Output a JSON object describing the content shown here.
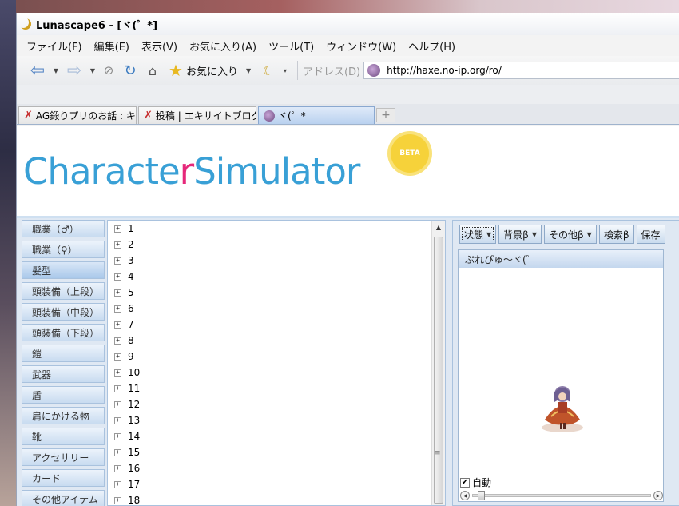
{
  "window": {
    "title": "Lunascape6 - [ヾ(゜*]"
  },
  "menu": [
    "ファイル(F)",
    "編集(E)",
    "表示(V)",
    "お気に入り(A)",
    "ツール(T)",
    "ウィンドウ(W)",
    "ヘルプ(H)"
  ],
  "toolbar": {
    "favorites_label": "お気に入り",
    "address_label": "アドレス(D)",
    "url": "http://haxe.no-ip.org/ro/"
  },
  "tabs": [
    {
      "label": "AG鍛りプリのお話 : キャ...",
      "active": false
    },
    {
      "label": "投稿 | エキサイトブログ",
      "active": false
    },
    {
      "label": "ヾ(゜*",
      "active": true
    }
  ],
  "banner": {
    "logo_main": "Characte",
    "logo_accent": "r",
    "logo_rest": "Simulator",
    "badge": "BETA"
  },
  "nav": [
    {
      "label": "職業（♂）",
      "selected": false
    },
    {
      "label": "職業（♀）",
      "selected": false
    },
    {
      "label": "髪型",
      "selected": true
    },
    {
      "label": "頭装備（上段）",
      "selected": false
    },
    {
      "label": "頭装備（中段）",
      "selected": false
    },
    {
      "label": "頭装備（下段）",
      "selected": false
    },
    {
      "label": "鎧",
      "selected": false
    },
    {
      "label": "武器",
      "selected": false
    },
    {
      "label": "盾",
      "selected": false
    },
    {
      "label": "肩にかける物",
      "selected": false
    },
    {
      "label": "靴",
      "selected": false
    },
    {
      "label": "アクセサリー",
      "selected": false
    },
    {
      "label": "カード",
      "selected": false
    },
    {
      "label": "その他アイテム",
      "selected": false
    }
  ],
  "tree_items": [
    "1",
    "2",
    "3",
    "4",
    "5",
    "6",
    "7",
    "8",
    "9",
    "10",
    "11",
    "12",
    "13",
    "14",
    "15",
    "16",
    "17",
    "18"
  ],
  "right_buttons": [
    {
      "label": "状態",
      "dropdown": true
    },
    {
      "label": "背景β",
      "dropdown": true
    },
    {
      "label": "その他β",
      "dropdown": true
    },
    {
      "label": "検索β",
      "dropdown": false
    },
    {
      "label": "保存",
      "dropdown": false
    }
  ],
  "preview": {
    "header": "ぷれぴゅ～ヾ(゜",
    "auto_label": "自動",
    "auto_checked": true
  }
}
